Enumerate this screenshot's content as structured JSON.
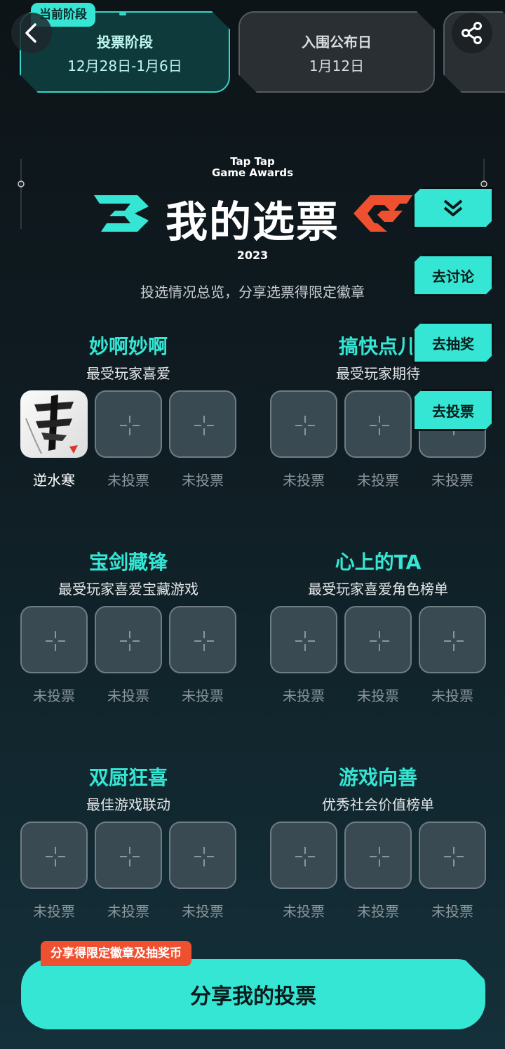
{
  "stages": {
    "current_badge": "当前阶段",
    "current": {
      "title": "投票阶段",
      "date": "12月28日-1月6日"
    },
    "next": {
      "title": "入围公布日",
      "date": "1月12日"
    }
  },
  "header": {
    "brand_line1": "Tap Tap",
    "brand_line2": "Game Awards",
    "title": "我的选票",
    "year": "2023",
    "subtitle": "投选情况总览，分享选票得限定徽章"
  },
  "side_buttons": {
    "discuss": "去讨论",
    "lottery": "去抽奖",
    "vote": "去投票"
  },
  "categories": [
    {
      "title": "妙啊妙啊",
      "subtitle": "最受玩家喜爱",
      "slots": [
        "逆水寒",
        "未投票",
        "未投票"
      ]
    },
    {
      "title": "搞快点儿",
      "subtitle": "最受玩家期待",
      "slots": [
        "未投票",
        "未投票",
        "未投票"
      ]
    },
    {
      "title": "宝剑藏锋",
      "subtitle": "最受玩家喜爱宝藏游戏",
      "slots": [
        "未投票",
        "未投票",
        "未投票"
      ]
    },
    {
      "title": "心上的TA",
      "subtitle": "最受玩家喜爱角色榜单",
      "slots": [
        "未投票",
        "未投票",
        "未投票"
      ]
    },
    {
      "title": "双厨狂喜",
      "subtitle": "最佳游戏联动",
      "slots": [
        "未投票",
        "未投票",
        "未投票"
      ]
    },
    {
      "title": "游戏向善",
      "subtitle": "优秀社会价值榜单",
      "slots": [
        "未投票",
        "未投票",
        "未投票"
      ]
    }
  ],
  "bottom": {
    "promo": "分享得限定徽章及抽奖币",
    "share_button": "分享我的投票"
  },
  "colors": {
    "accent": "#35e6d4",
    "promo": "#ef5030",
    "background": "#0f1c22"
  },
  "icons": {
    "back": "chevron-left-icon",
    "share": "share-icon",
    "collapse": "chevron-double-down-icon"
  }
}
